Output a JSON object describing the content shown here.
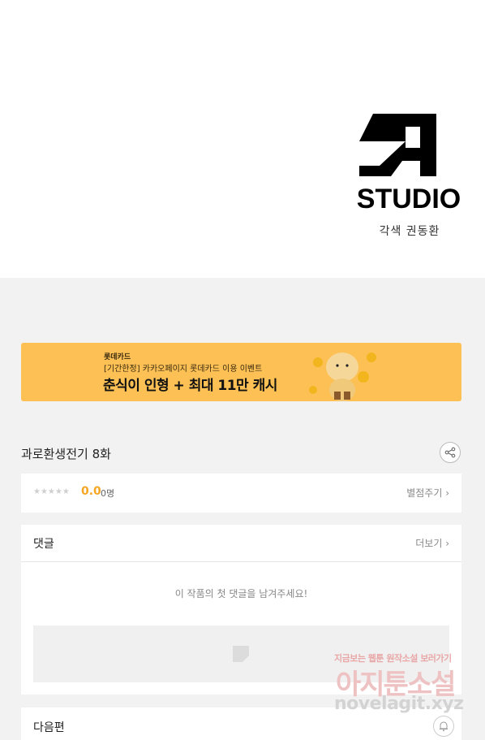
{
  "studio": {
    "logo_text": "STUDIO",
    "credit": "각색 권동환"
  },
  "banner": {
    "brand": "롯데카드",
    "subtitle": "[기간한정] 카카오페이지 롯데카드 이용 이벤트",
    "title": "춘식이 인형 + 최대 11만 캐시",
    "bg_color": "#fcc054"
  },
  "episode": {
    "title": "과로환생전기 8화",
    "share_icon": "share-icon"
  },
  "rating": {
    "stars": "★★★★★",
    "score": "0.0",
    "count": "0명",
    "rate_button": "별점주기 ›"
  },
  "comments": {
    "title": "댓글",
    "more": "더보기 ›",
    "empty_message": "이 작품의 첫 댓글을 남겨주세요!"
  },
  "next": {
    "label": "다음편"
  },
  "watermark": {
    "line1": "지금보는 웹툰 원작소설 보러가기",
    "line2": "아지툰소설",
    "line3": "novelagit.xyz"
  }
}
